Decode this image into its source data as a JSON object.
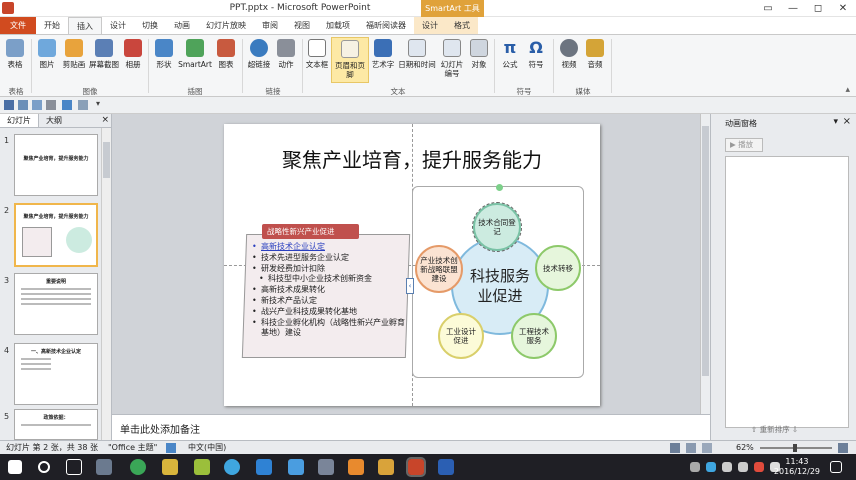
{
  "window": {
    "title": "PPT.pptx - Microsoft PowerPoint",
    "context_tools": "SmartArt 工具",
    "controls": [
      "▭",
      "—",
      "◻",
      "✕"
    ]
  },
  "tabs": [
    "文件",
    "开始",
    "插入",
    "设计",
    "切换",
    "动画",
    "幻灯片放映",
    "审阅",
    "视图",
    "加载项",
    "福昕阅读器",
    "设计",
    "格式"
  ],
  "ribbon": {
    "buttons": [
      "表格",
      "图片",
      "剪贴画",
      "屏幕截图",
      "相册",
      "形状",
      "SmartArt",
      "图表",
      "超链接",
      "动作",
      "文本框",
      "页眉和页脚",
      "艺术字",
      "日期和时间",
      "幻灯片编号",
      "对象",
      "公式",
      "符号",
      "视频",
      "音频"
    ],
    "groups": [
      "表格",
      "图像",
      "插图",
      "链接",
      "文本",
      "符号",
      "媒体"
    ]
  },
  "left_panel": {
    "tabs": [
      "幻灯片",
      "大纲"
    ],
    "close": "×",
    "thumbs": [
      {
        "num": "1",
        "title": "聚焦产业培育，提升服务能力"
      },
      {
        "num": "2",
        "title": "聚焦产业培育，提升服务能力"
      },
      {
        "num": "3",
        "title": "重要说明"
      },
      {
        "num": "4",
        "title": "一、高新技术企业认定"
      },
      {
        "num": "5",
        "title": "政策依据："
      }
    ]
  },
  "slide": {
    "title": "聚焦产业培育，提升服务能力",
    "box_header": "战略性新兴产业促进",
    "bullets": [
      "高新技术企业认定",
      "技术先进型服务企业认定",
      "研发经费加计扣除",
      "科技型中小企业技术创新资金",
      "高新技术成果转化",
      "新技术产品认定",
      "战兴产业科技成果转化基地",
      "科技企业孵化机构（战略性新兴产业孵育基地）建设"
    ],
    "smartart": {
      "center": "科技服务业促进",
      "nodes": [
        "技术合同登记",
        "技术转移",
        "工程技术服务",
        "工业设计促进",
        "产业技术创新战略联盟建设"
      ]
    }
  },
  "notes": {
    "placeholder": "单击此处添加备注"
  },
  "animation_pane": {
    "title": "动画窗格",
    "play": "播放",
    "reorder": "重新排序"
  },
  "status": {
    "slide": "幻灯片 第 2 张，共 38 张",
    "theme": "\"Office 主题\"",
    "lang": "中文(中国)",
    "zoom": "62%"
  },
  "clock": {
    "time": "11:43",
    "date": "2016/12/29"
  },
  "colors": {
    "file_tab": "#d14b1f",
    "smartart_tab": "#e0a23a",
    "box_header": "#c0504d"
  }
}
